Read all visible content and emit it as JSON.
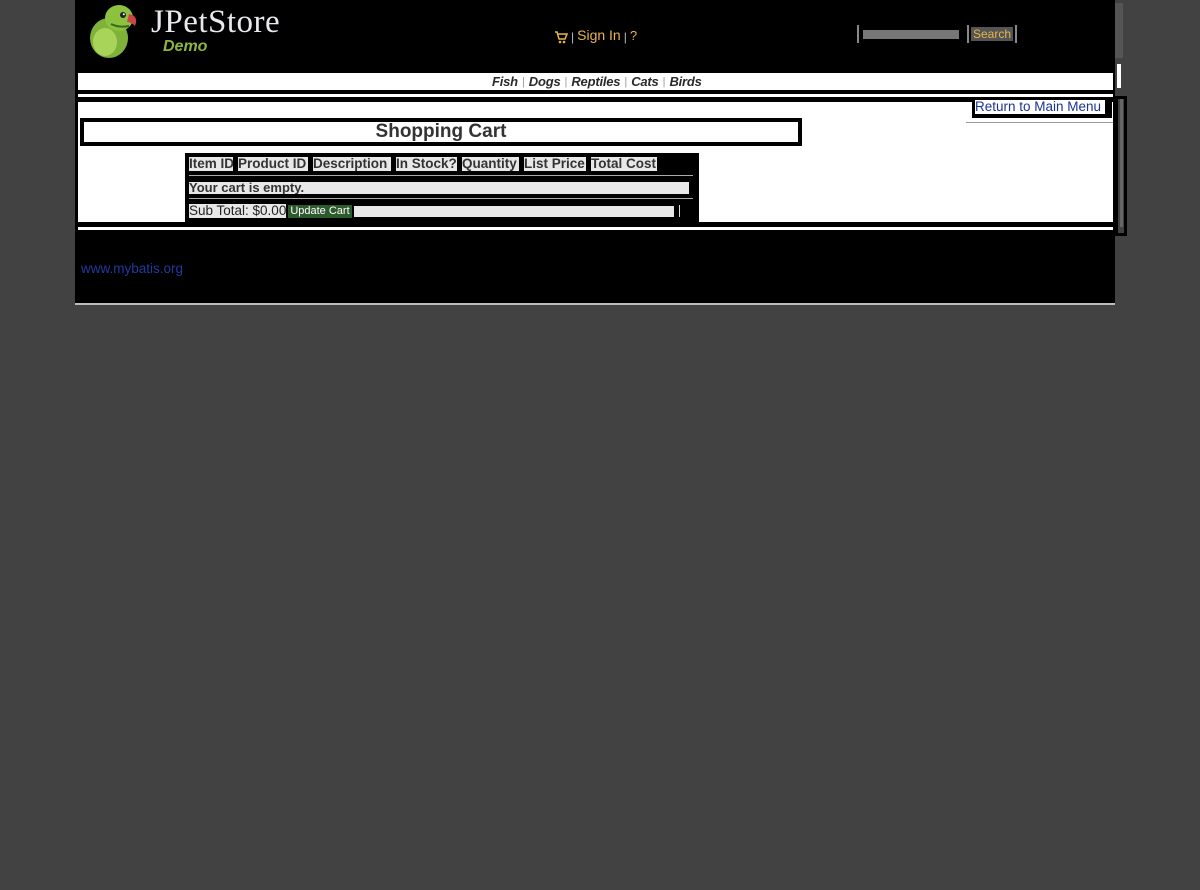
{
  "header": {
    "logo_word": "JPetStore",
    "logo_tagline": "Demo",
    "menu": {
      "cart_icon": "cart-icon",
      "sign_in": "Sign In",
      "help": "?"
    },
    "search": {
      "placeholder": "",
      "button_label": "Search"
    }
  },
  "quick_links": [
    "Fish",
    "Dogs",
    "Reptiles",
    "Cats",
    "Birds"
  ],
  "content": {
    "return_link": "Return to Main Menu",
    "title": "Shopping Cart",
    "table": {
      "columns": [
        "Item ID",
        "Product ID",
        "Description",
        "In Stock?",
        "Quantity",
        "List Price",
        "Total Cost"
      ],
      "empty_message": "Your cart is empty.",
      "subtotal": "Sub Total: $0.00",
      "update_button": "Update Cart"
    }
  },
  "footer": {
    "link": "www.mybatis.org"
  },
  "colors": {
    "background": "#424242",
    "page": "#000000",
    "menu_accent": "#e7b54a",
    "logo_green": "#8db53e",
    "link_blue": "#1f3aa0",
    "update_button": "#2d5a2d"
  }
}
